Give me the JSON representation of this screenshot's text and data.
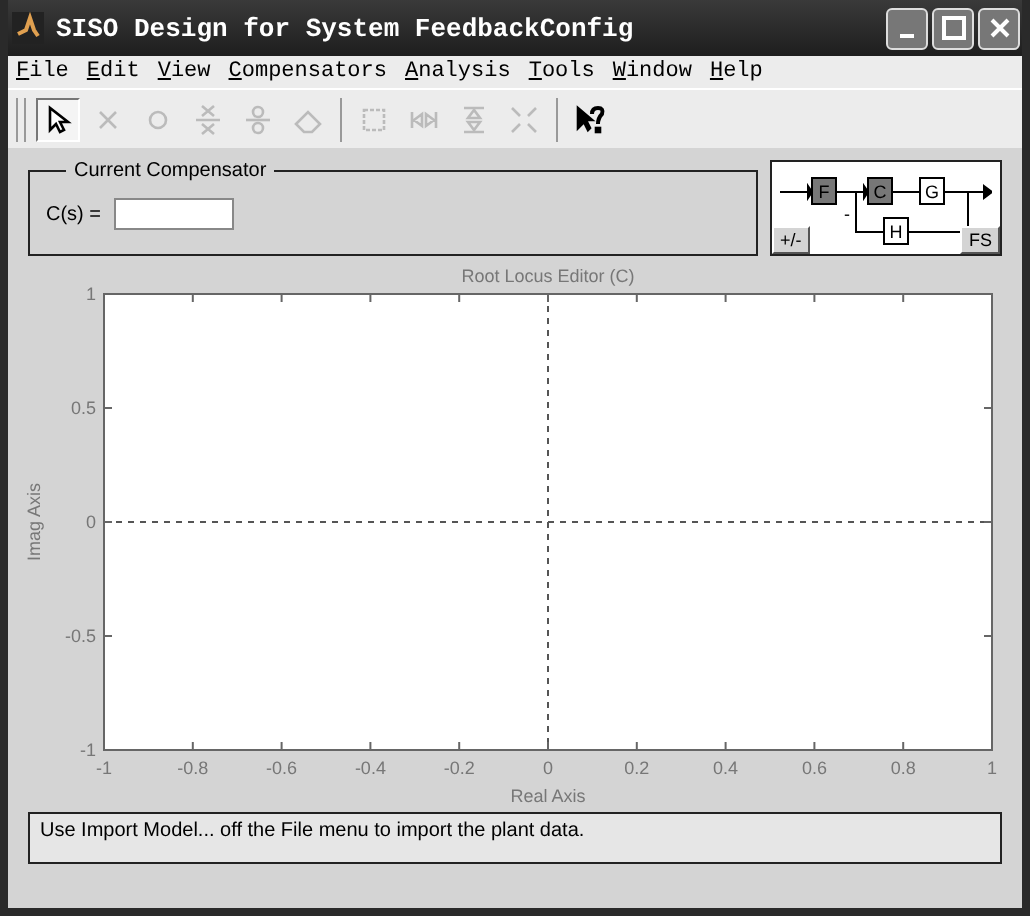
{
  "window": {
    "title": "SISO Design for System FeedbackConfig"
  },
  "menu": [
    "File",
    "Edit",
    "View",
    "Compensators",
    "Analysis",
    "Tools",
    "Window",
    "Help"
  ],
  "toolbar": [
    {
      "kind": "pointer",
      "selected": true,
      "disabled": false
    },
    {
      "kind": "add-pole",
      "selected": false,
      "disabled": true
    },
    {
      "kind": "add-zero",
      "selected": false,
      "disabled": true
    },
    {
      "kind": "add-pole-pair",
      "selected": false,
      "disabled": true
    },
    {
      "kind": "add-zero-pair",
      "selected": false,
      "disabled": true
    },
    {
      "kind": "eraser",
      "selected": false,
      "disabled": true
    },
    {
      "kind": "zoom-box",
      "selected": false,
      "disabled": true
    },
    {
      "kind": "zoom-x",
      "selected": false,
      "disabled": true
    },
    {
      "kind": "zoom-y",
      "selected": false,
      "disabled": true
    },
    {
      "kind": "fit",
      "selected": false,
      "disabled": true
    },
    {
      "kind": "help",
      "selected": false,
      "disabled": false
    }
  ],
  "compensator": {
    "title": "Current Compensator",
    "label": "C(s) ="
  },
  "loop_diagram": {
    "blocks": [
      "F",
      "C",
      "G",
      "H"
    ],
    "sign": "-",
    "buttons": [
      "+/-",
      "FS"
    ]
  },
  "plot": {
    "chart_data": {
      "type": "line",
      "title": "Root Locus Editor (C)",
      "xlabel": "Real Axis",
      "ylabel": "Imag Axis",
      "xlim": [
        -1,
        1
      ],
      "ylim": [
        -1,
        1
      ],
      "xticks": [
        -1,
        -0.8,
        -0.6,
        -0.4,
        -0.2,
        0,
        0.2,
        0.4,
        0.6,
        0.8,
        1
      ],
      "yticks": [
        -1,
        -0.5,
        0,
        0.5,
        1
      ]
    }
  },
  "status_bar": "Use Import Model... off the File menu to import the plant data."
}
